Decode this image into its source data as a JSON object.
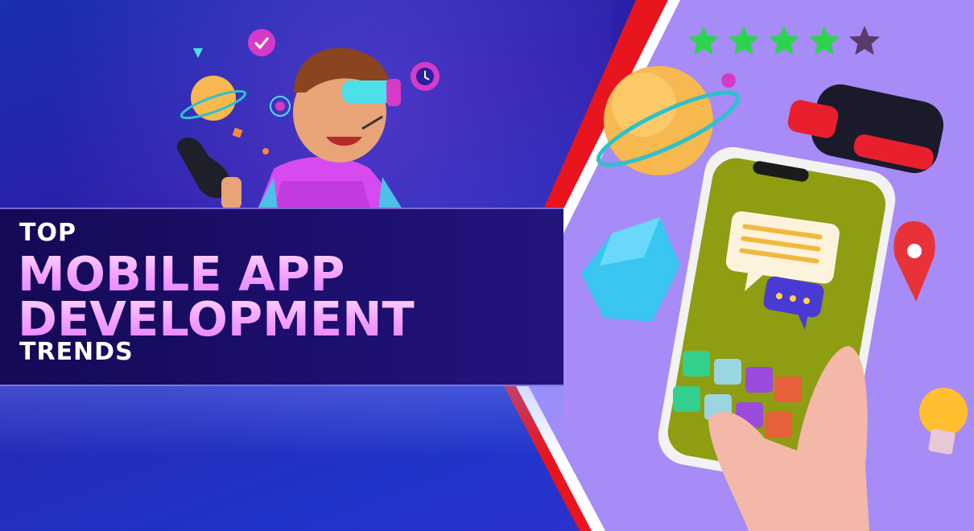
{
  "title": {
    "top": "TOP",
    "line1": "MOBILE APP",
    "line2": "DEVELOPMENT",
    "bottom": "TRENDS"
  },
  "rating": {
    "filled": 4,
    "total": 5
  },
  "colors": {
    "accent_red": "#e8141e",
    "panel_purple": "#a78bf7",
    "title_pink": "#f2a6ff",
    "star_green": "#2bd44b",
    "phone_screen": "#8f9d12"
  },
  "icons": [
    "checkmark-badge-icon",
    "clock-gear-icon",
    "planet-icon",
    "vr-headset-icon",
    "map-pin-icon",
    "lightbulb-icon",
    "chat-bubble-icon",
    "typing-bubble-icon",
    "gem-icon",
    "star-icon"
  ]
}
